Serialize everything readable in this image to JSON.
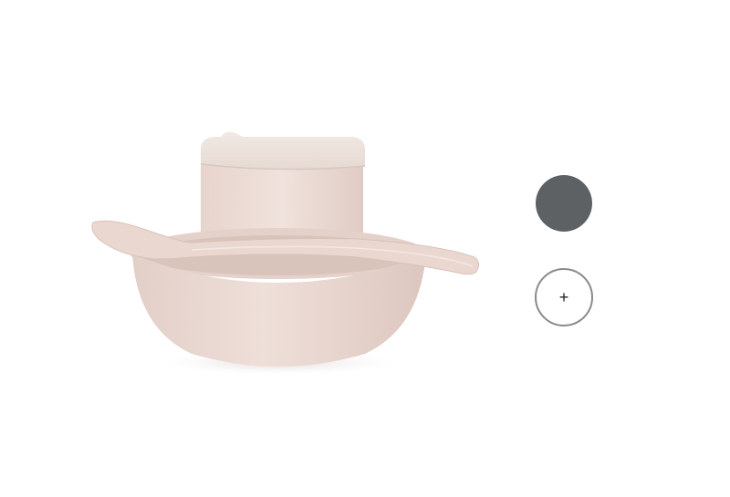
{
  "product": {
    "image_icon": "tableware-set-image",
    "colors": {
      "lid": "#ece3de",
      "cup": "#ecd9d2",
      "bowl": "#ead8d1",
      "spoon": "#ead7d0",
      "shadow": "#c9b7b0"
    }
  },
  "swatches": {
    "selected_color": "#5e6163",
    "add_label": "+"
  }
}
